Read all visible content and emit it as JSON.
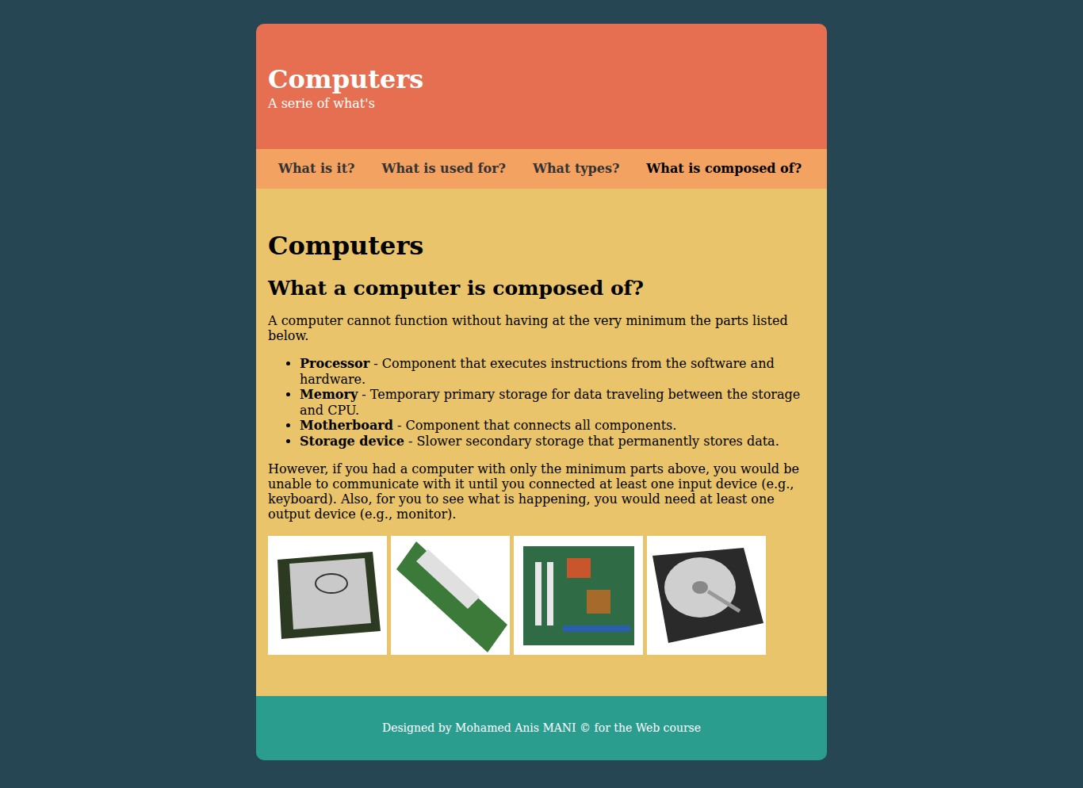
{
  "header": {
    "title": "Computers",
    "subtitle": "A serie of what's"
  },
  "nav": [
    {
      "label": "What is it?",
      "selected": false
    },
    {
      "label": "What is used for?",
      "selected": false
    },
    {
      "label": "What types?",
      "selected": false
    },
    {
      "label": "What is composed of?",
      "selected": true
    }
  ],
  "main": {
    "heading": "Computers",
    "subheading": "What a computer is composed of?",
    "intro": "A computer cannot function without having at the very minimum the parts listed below.",
    "parts": [
      {
        "term": "Processor",
        "description": " - Component that executes instructions from the software and hardware."
      },
      {
        "term": "Memory",
        "description": " - Temporary primary storage for data traveling between the storage and CPU."
      },
      {
        "term": "Motherboard",
        "description": " - Component that connects all components."
      },
      {
        "term": "Storage device",
        "description": " - Slower secondary storage that permanently stores data."
      }
    ],
    "closing": "However, if you had a computer with only the minimum parts above, you would be unable to communicate with it until you connected at least one input device (e.g., keyboard). Also, for you to see what is happening, you would need at least one output device (e.g., monitor)."
  },
  "footer": {
    "text": "Designed by Mohamed Anis MANI © for the Web course"
  }
}
